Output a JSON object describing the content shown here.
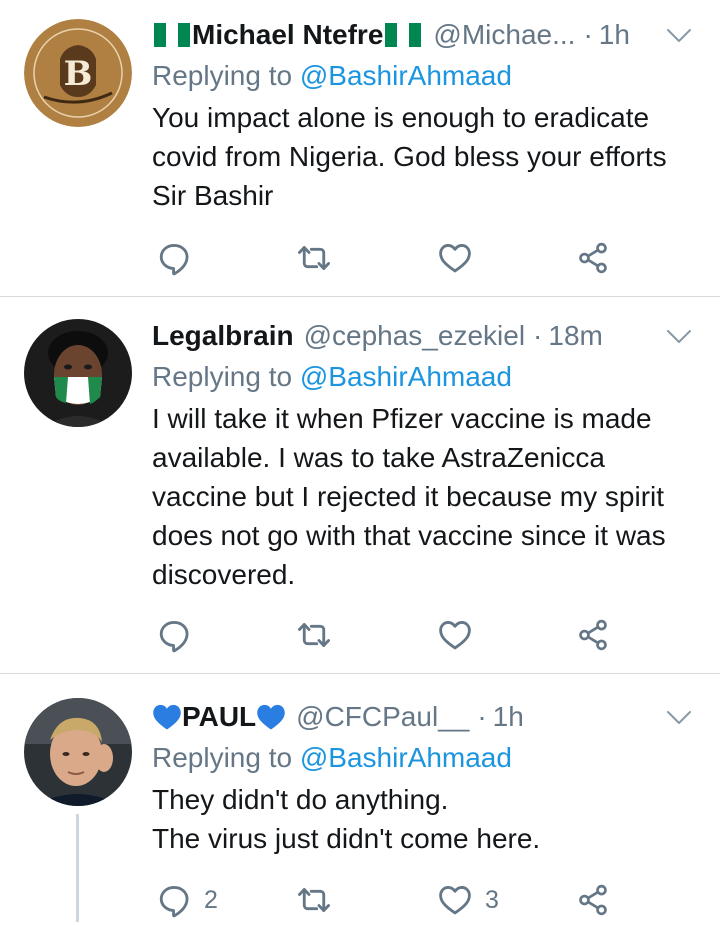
{
  "tweets": [
    {
      "name": "Michael Ntefre",
      "handle": "@Michae...",
      "time": "1h",
      "replying_prefix": "Replying to",
      "replying_to": "@BashirAhmaad",
      "body": "You impact alone is enough to eradicate covid from Nigeria. God bless your efforts Sir Bashir",
      "avatar_logo": "Bashir Ahmad Foundation",
      "name_decoration": "nigeria-flag-emoji",
      "replies": "",
      "retweets": "",
      "likes": ""
    },
    {
      "name": "Legalbrain",
      "handle": "@cephas_ezekiel",
      "time": "18m",
      "replying_prefix": "Replying to",
      "replying_to": "@BashirAhmaad",
      "body": "I will take it when Pfizer vaccine is made available. I was to take AstraZenicca vaccine but I rejected it because my spirit does not go with that vaccine since it was discovered.",
      "name_decoration": "",
      "replies": "",
      "retweets": "",
      "likes": ""
    },
    {
      "name": "PAUL",
      "handle": "@CFCPaul__",
      "time": "1h",
      "replying_prefix": "Replying to",
      "replying_to": "@BashirAhmaad",
      "body": "They didn't do anything.\nThe virus just didn't come here.",
      "name_decoration": "blue-heart-emoji",
      "replies": "2",
      "retweets": "",
      "likes": "3"
    }
  ],
  "colors": {
    "text": "#14171a",
    "secondary": "#657786",
    "link": "#1b95e0",
    "divider": "#d6dbdf",
    "thread_line": "#ccd6dd",
    "flag_green": "#008751",
    "heart_blue": "#2a7de1"
  },
  "icons": [
    "reply-icon",
    "retweet-icon",
    "like-icon",
    "share-icon",
    "chevron-down-icon"
  ]
}
